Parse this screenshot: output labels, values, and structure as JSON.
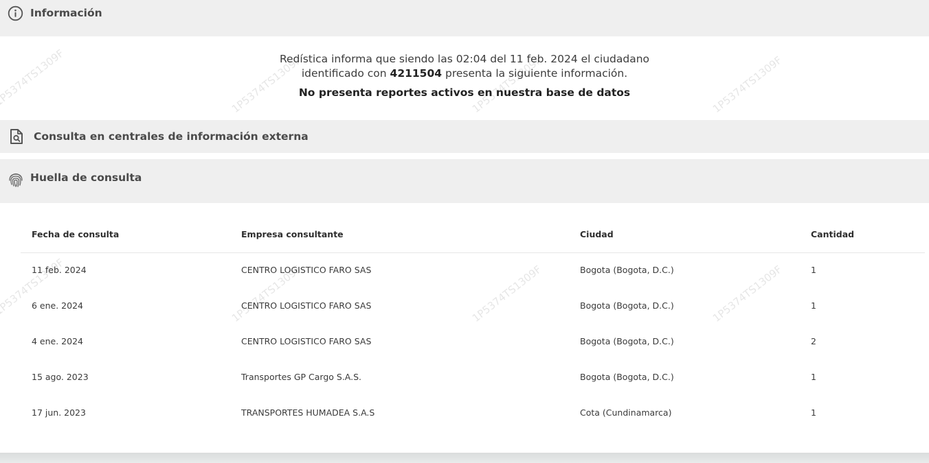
{
  "info_section": {
    "title": "Información",
    "line1": "Redística informa que siendo las 02:04 del 11 feb. 2024 el ciudadano",
    "line2_prefix": "identificado con ",
    "line2_id": "4211504",
    "line2_suffix": " presenta la siguiente información.",
    "status": "No presenta reportes activos en nuestra base de datos"
  },
  "external_section": {
    "title": "Consulta en centrales de información externa"
  },
  "huella_section": {
    "title": "Huella de consulta",
    "columns": [
      "Fecha de consulta",
      "Empresa consultante",
      "Ciudad",
      "Cantidad"
    ],
    "rows": [
      [
        "11 feb. 2024",
        "CENTRO LOGISTICO FARO SAS",
        "Bogota (Bogota, D.C.)",
        "1"
      ],
      [
        "6 ene. 2024",
        "CENTRO LOGISTICO FARO SAS",
        "Bogota (Bogota, D.C.)",
        "1"
      ],
      [
        "4 ene. 2024",
        "CENTRO LOGISTICO FARO SAS",
        "Bogota (Bogota, D.C.)",
        "2"
      ],
      [
        "15 ago. 2023",
        "Transportes GP Cargo S.A.S.",
        "Bogota (Bogota, D.C.)",
        "1"
      ],
      [
        "17 jun. 2023",
        "TRANSPORTES HUMADEA S.A.S",
        "Cota (Cundinamarca)",
        "1"
      ]
    ]
  },
  "watermark": "1P5374TS1309F",
  "icons": {
    "info": "info-circle-icon",
    "external": "document-search-icon",
    "huella": "fingerprint-icon"
  },
  "colors": {
    "header_bg": "#efefef",
    "body_bg": "#ffffff",
    "page_bg": "#e8eaea"
  }
}
